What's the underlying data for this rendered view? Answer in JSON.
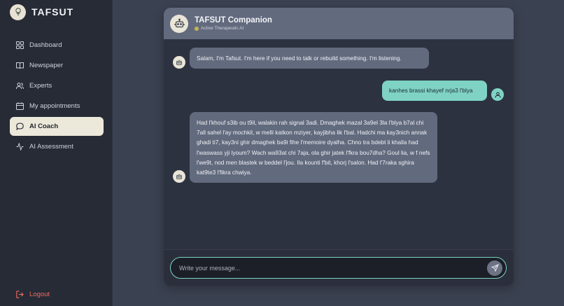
{
  "brand": {
    "name": "TAFSUT",
    "logo_icon": "tree-icon"
  },
  "sidebar": {
    "items": [
      {
        "label": "Dashboard",
        "icon": "grid-icon",
        "active": false
      },
      {
        "label": "Newspaper",
        "icon": "book-icon",
        "active": false
      },
      {
        "label": "Experts",
        "icon": "users-icon",
        "active": false
      },
      {
        "label": "My appointments",
        "icon": "calendar-icon",
        "active": false
      },
      {
        "label": "AI Coach",
        "icon": "chat-bubble-icon",
        "active": true
      },
      {
        "label": "AI Assessment",
        "icon": "activity-icon",
        "active": false
      }
    ],
    "logout_label": "Logout"
  },
  "chat": {
    "title": "TAFSUT Companion",
    "status": "Active Therapeutic AI",
    "messages": [
      {
        "from": "bot",
        "text": "Salam, I'm Tafsut. I'm here if you need to talk or rebuild something. I'm listening."
      },
      {
        "from": "user",
        "text": "kanhes brassi khayef nrja3 l'blya"
      },
      {
        "from": "bot",
        "text": "Had l'khouf s3ib ou t9il, walakin rah signal 3adi. Dmaghek mazal 3a9el 3la l'blya b7al chi 7all sahel l'ay mochkil, w melli katkon mziyer, kayjibha lik l'bal. Hadchi ma kay3nich annak ghadi ti7, kay3ni ghir dmaghek ba9i fihe l'memoire dyalha. Chno tra bdebt li khalla had l'waswass yji lyoum? Wach wa93at chi 7aja, ola ghir jatek l'fkra bou7dha? Goul lia, w f nefs l'we9t, nod men blastek w beddel l'jou. Ila kounti f'bit, khorj l'salon. Had l'7raka sghira kat9te3 l'fikra chwiya."
      }
    ],
    "input_placeholder": "Write your message...",
    "colors": {
      "accent": "#7fd3c4",
      "bot_bubble": "#626a7e",
      "logout": "#f26b5f"
    }
  }
}
